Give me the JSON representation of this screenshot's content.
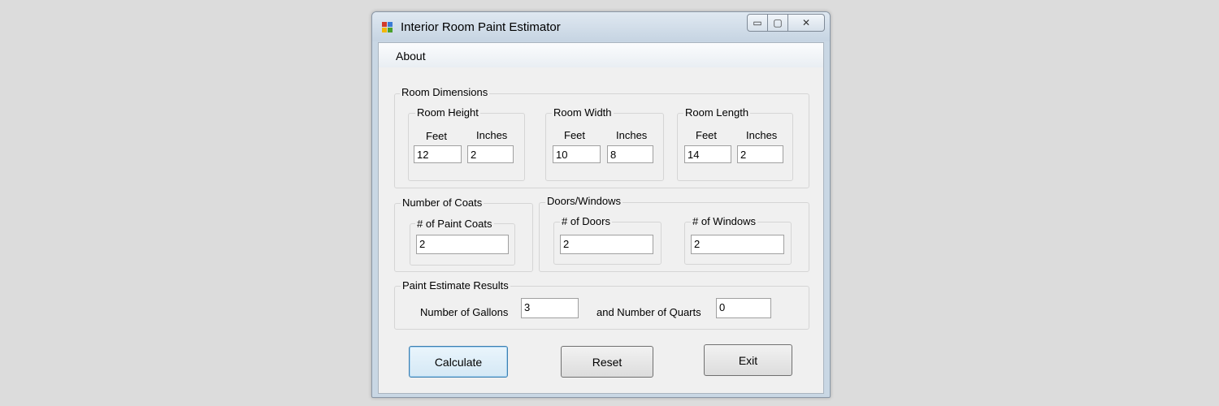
{
  "window": {
    "title": "Interior Room Paint Estimator",
    "controls": {
      "minimize": "▭",
      "maximize": "▢",
      "close": "✕"
    }
  },
  "menu": {
    "about": "About"
  },
  "room_dimensions": {
    "title": "Room Dimensions",
    "height": {
      "title": "Room Height",
      "feet_label": "Feet",
      "inches_label": "Inches",
      "feet": "12",
      "inches": "2"
    },
    "width": {
      "title": "Room Width",
      "feet_label": "Feet",
      "inches_label": "Inches",
      "feet": "10",
      "inches": "8"
    },
    "length": {
      "title": "Room Length",
      "feet_label": "Feet",
      "inches_label": "Inches",
      "feet": "14",
      "inches": "2"
    }
  },
  "coats": {
    "title": "Number of Coats",
    "sub_title": "# of Paint Coats",
    "value": "2"
  },
  "doors_windows": {
    "title": "Doors/Windows",
    "doors_title": "# of Doors",
    "doors": "2",
    "windows_title": "# of Windows",
    "windows": "2"
  },
  "results": {
    "title": "Paint Estimate Results",
    "gallons_label": "Number of Gallons",
    "gallons": "3",
    "quarts_label": "and Number of Quarts",
    "quarts": "0"
  },
  "buttons": {
    "calculate": "Calculate",
    "reset": "Reset",
    "exit": "Exit"
  },
  "colors": {
    "title_gradient_top": "#dfe8f1",
    "client_bg": "#f0f0f0",
    "default_button_border": "#3c7fb1"
  }
}
